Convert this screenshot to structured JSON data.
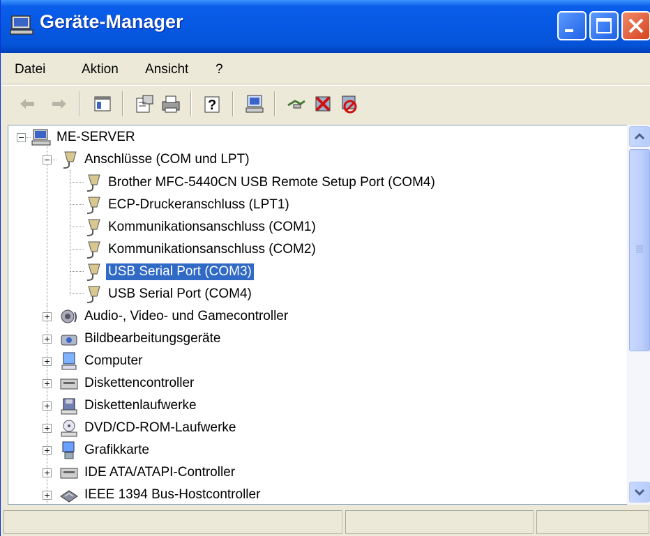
{
  "window": {
    "title": "Geräte-Manager"
  },
  "menu": [
    "Datei",
    "Aktion",
    "Ansicht",
    "?"
  ],
  "toolbar_icons": [
    "back-icon",
    "forward-icon",
    "show-hide-tree-icon",
    "properties-icon",
    "print-icon",
    "help-icon",
    "scan-hardware-icon",
    "update-driver-icon",
    "uninstall-icon",
    "disable-icon"
  ],
  "tree": {
    "root": "ME-SERVER",
    "ports_group": "Anschlüsse (COM und LPT)",
    "ports": [
      "Brother MFC-5440CN USB Remote Setup Port (COM4)",
      "ECP-Druckeranschluss (LPT1)",
      "Kommunikationsanschluss (COM1)",
      "Kommunikationsanschluss (COM2)",
      "USB Serial Port (COM3)",
      "USB Serial Port (COM4)"
    ],
    "selected_port_index": 4,
    "categories": [
      "Audio-, Video- und Gamecontroller",
      "Bildbearbeitungsgeräte",
      "Computer",
      "Diskettencontroller",
      "Diskettenlaufwerke",
      "DVD/CD-ROM-Laufwerke",
      "Grafikkarte",
      "IDE ATA/ATAPI-Controller",
      "IEEE 1394 Bus-Hostcontroller"
    ]
  },
  "colors": {
    "selection": "#316ac5",
    "titlebar": "#0a5ee9"
  }
}
